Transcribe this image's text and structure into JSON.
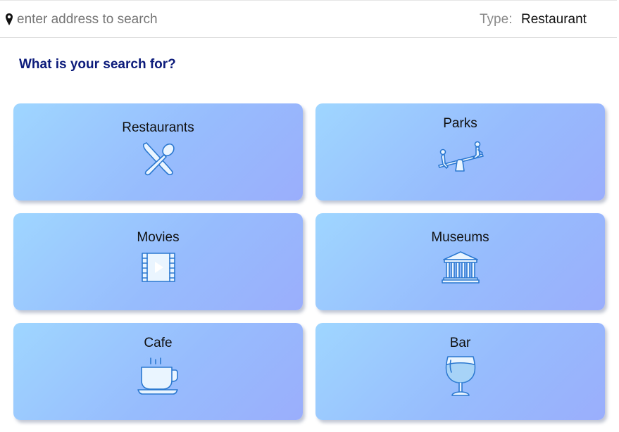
{
  "search": {
    "placeholder": "enter address to search",
    "value": "",
    "icon": "map-pin-icon"
  },
  "type_filter": {
    "label": "Type:",
    "value": "Restaurant"
  },
  "main": {
    "heading": "What is your search for?"
  },
  "categories": [
    {
      "label": "Restaurants",
      "icon": "fork-spoon-icon"
    },
    {
      "label": "Parks",
      "icon": "seesaw-icon"
    },
    {
      "label": "Movies",
      "icon": "film-play-icon"
    },
    {
      "label": "Museums",
      "icon": "museum-building-icon"
    },
    {
      "label": "Cafe",
      "icon": "coffee-cup-icon"
    },
    {
      "label": "Bar",
      "icon": "wine-glass-icon"
    }
  ],
  "colors": {
    "heading": "#0b1a7a",
    "card_gradient_start": "#9fd6ff",
    "card_gradient_end": "#9aaefc",
    "icon_stroke": "#2b78d0"
  }
}
